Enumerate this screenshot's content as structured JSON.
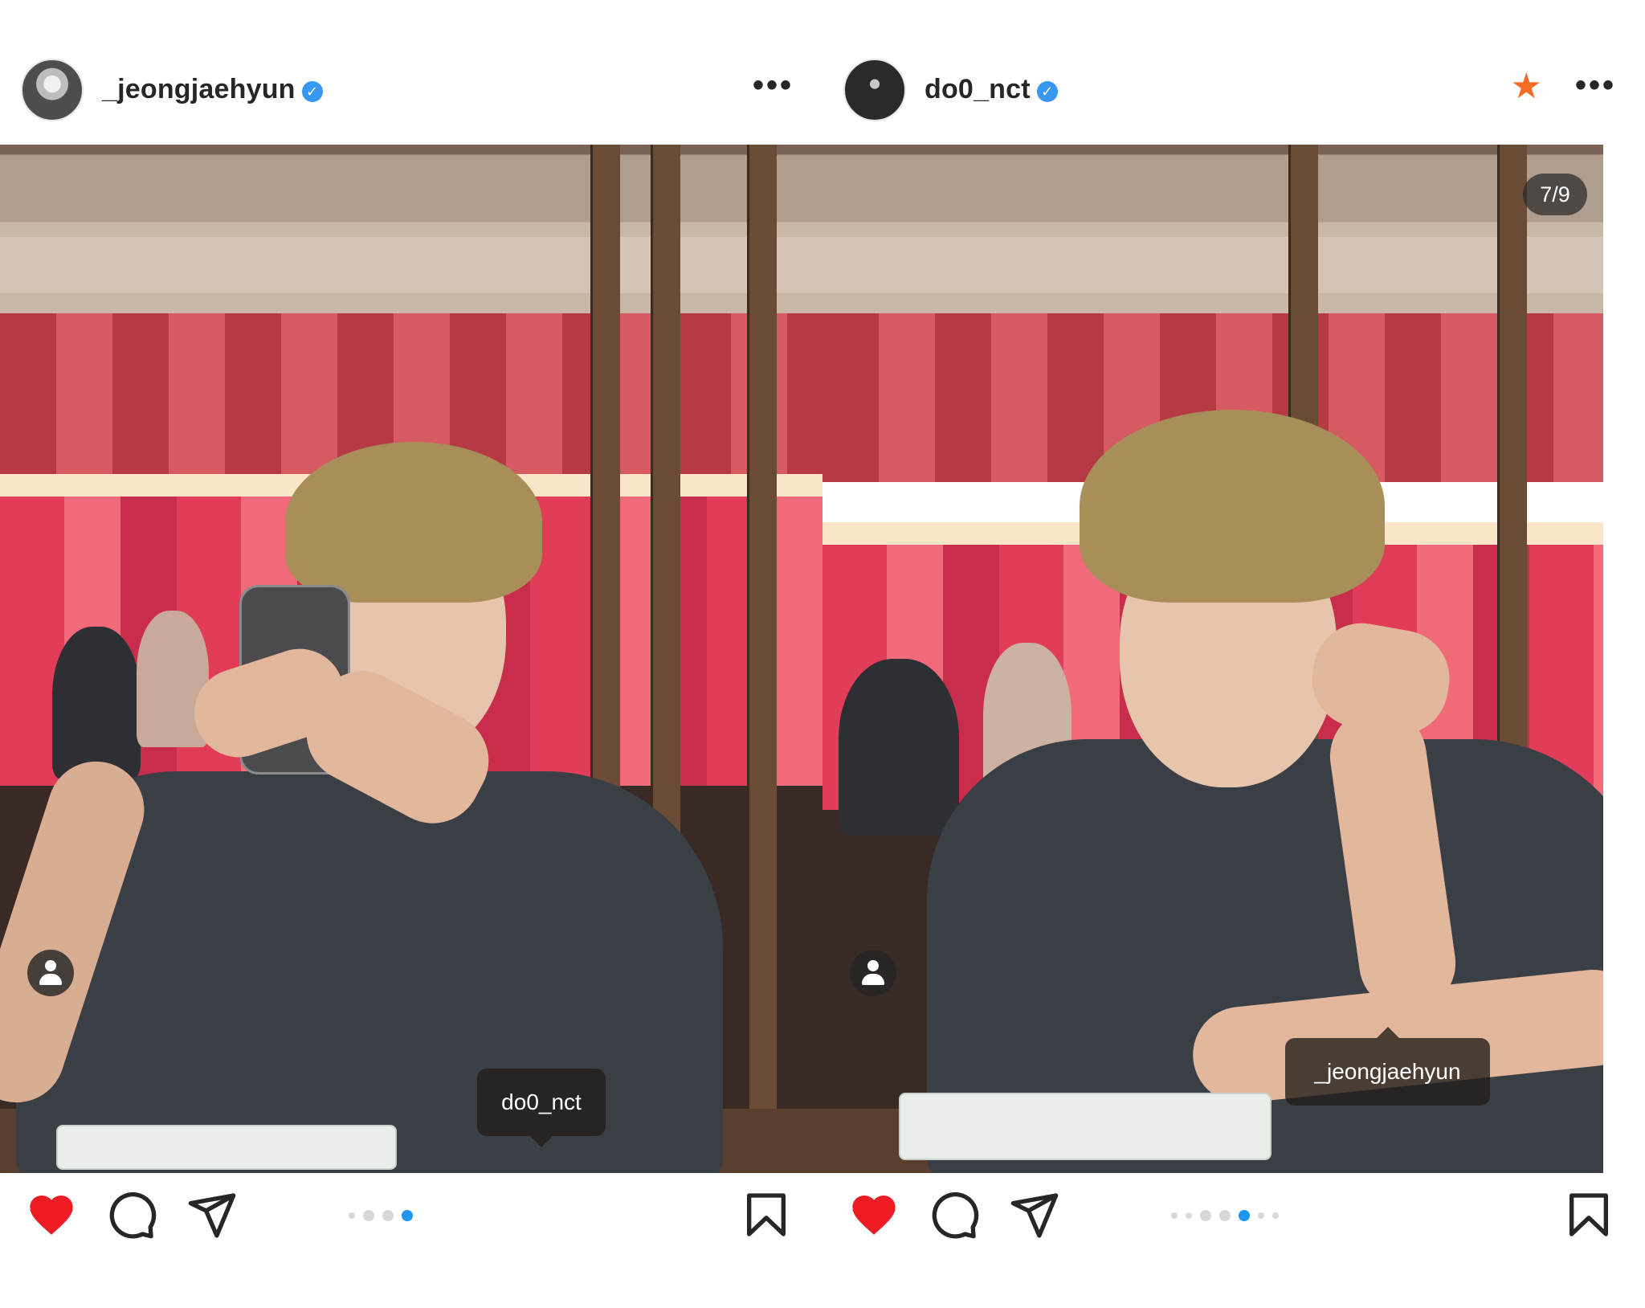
{
  "colors": {
    "like_red": "#ed1c24",
    "verified_blue": "#3897f0",
    "active_dot": "#1f95f2",
    "star_orange": "#f56c27"
  },
  "posts": [
    {
      "username": "_jeongjaehyun",
      "verified_icon": "verified-badge-icon",
      "more_icon": "more-options-icon",
      "more_label": "•••",
      "tag_label": "do0_nct",
      "liked": true,
      "carousel_dots": 4,
      "carousel_active_index": 3
    },
    {
      "username": "do0_nct",
      "verified_icon": "verified-badge-icon",
      "star_icon": "favorite-star-icon",
      "star_label": "★",
      "more_label": "•••",
      "counter": "7/9",
      "tag_label": "_jeongjaehyun",
      "liked": true,
      "carousel_dots": 7,
      "carousel_active_index": 4
    }
  ]
}
